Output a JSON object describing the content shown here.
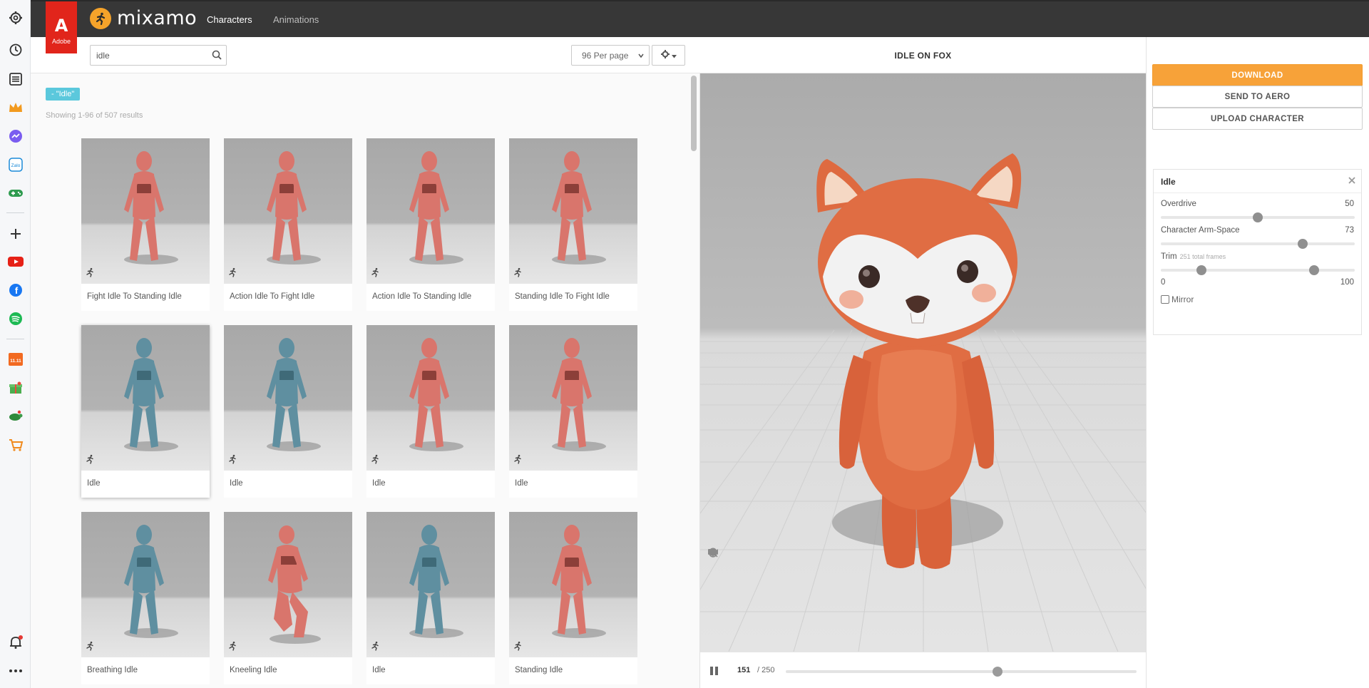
{
  "header": {
    "adobe_label": "Adobe",
    "brand": "mixamo",
    "nav": [
      {
        "label": "Characters",
        "active": true
      },
      {
        "label": "Animations",
        "active": false
      }
    ]
  },
  "browser_rail": {
    "icons": [
      "gear-icon",
      "history-icon",
      "list-icon",
      "crown-icon",
      "messenger-icon",
      "zalo-icon",
      "gamepad-icon",
      "plus-icon",
      "youtube-icon",
      "facebook-icon",
      "spotify-icon",
      "shop-icon",
      "gift-icon",
      "turtle-icon",
      "cart-icon",
      "bell-icon",
      "more-icon"
    ]
  },
  "search": {
    "value": "idle",
    "placeholder": "Search"
  },
  "per_page": {
    "selected": "96 Per page"
  },
  "filter_tag": "- \"Idle\"",
  "results_text": "Showing 1-96 of 507 results",
  "cards": [
    {
      "label": "Fight Idle To Standing Idle",
      "color": "red"
    },
    {
      "label": "Action Idle To Fight Idle",
      "color": "red"
    },
    {
      "label": "Action Idle To Standing Idle",
      "color": "red"
    },
    {
      "label": "Standing Idle To Fight Idle",
      "color": "red"
    },
    {
      "label": "Idle",
      "color": "blue",
      "selected": true
    },
    {
      "label": "Idle",
      "color": "blue"
    },
    {
      "label": "Idle",
      "color": "red"
    },
    {
      "label": "Idle",
      "color": "red"
    },
    {
      "label": "Breathing Idle",
      "color": "blue"
    },
    {
      "label": "Kneeling Idle",
      "color": "red"
    },
    {
      "label": "Idle",
      "color": "blue"
    },
    {
      "label": "Standing Idle",
      "color": "red"
    }
  ],
  "viewer": {
    "title": "IDLE ON FOX",
    "frame_current": "151",
    "frame_total": "/ 250",
    "progress": 0.604
  },
  "actions": {
    "download": "DOWNLOAD",
    "send": "SEND TO AERO",
    "upload": "UPLOAD CHARACTER"
  },
  "settings": {
    "title": "Idle",
    "overdrive": {
      "label": "Overdrive",
      "value": "50",
      "fraction": 0.5
    },
    "arm_space": {
      "label": "Character Arm-Space",
      "value": "73",
      "fraction": 0.73
    },
    "trim": {
      "label": "Trim",
      "sub": "251 total frames",
      "min": "0",
      "max": "100",
      "start": 0.21,
      "end": 0.79
    },
    "mirror": "Mirror"
  },
  "colors": {
    "brand_orange": "#f7a239",
    "topbar": "#373737",
    "adobe_red": "#e1251b",
    "tag_cyan": "#5bc8dc",
    "figure_red": "#d9756c",
    "figure_blue": "#5f8fa0",
    "fox_orange": "#e06d43"
  }
}
